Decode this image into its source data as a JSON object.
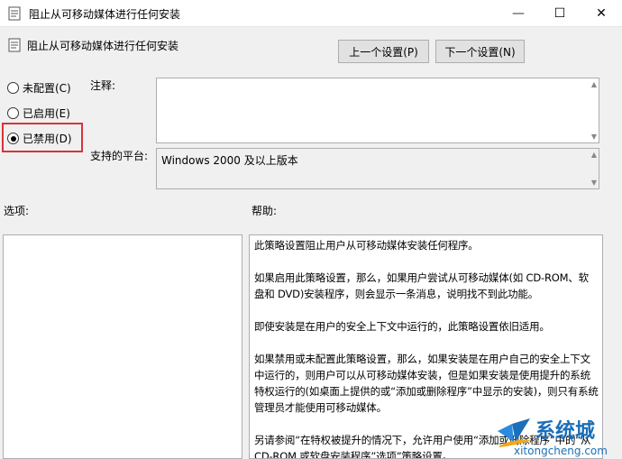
{
  "window": {
    "title": "阻止从可移动媒体进行任何安装",
    "controls": {
      "minimize": "—",
      "maximize": "☐",
      "close": "✕"
    }
  },
  "header": {
    "policy_name": "阻止从可移动媒体进行任何安装",
    "prev_button": "上一个设置(P)",
    "next_button": "下一个设置(N)"
  },
  "state": {
    "options": [
      {
        "label": "未配置(C)",
        "selected": false
      },
      {
        "label": "已启用(E)",
        "selected": false
      },
      {
        "label": "已禁用(D)",
        "selected": true
      }
    ],
    "highlight_color": "#d9333b"
  },
  "comment": {
    "label": "注释:",
    "value": ""
  },
  "platform": {
    "label": "支持的平台:",
    "value": "Windows 2000 及以上版本"
  },
  "options_pane": {
    "label": "选项:"
  },
  "help_pane": {
    "label": "帮助:",
    "paragraphs": [
      "此策略设置阻止用户从可移动媒体安装任何程序。",
      "如果启用此策略设置，那么，如果用户尝试从可移动媒体(如 CD-ROM、软盘和 DVD)安装程序，则会显示一条消息，说明找不到此功能。",
      "即使安装是在用户的安全上下文中运行的，此策略设置依旧适用。",
      "如果禁用或未配置此策略设置，那么，如果安装是在用户自己的安全上下文中运行的，则用户可以从可移动媒体安装，但是如果安装是使用提升的系统特权运行的(如桌面上提供的或“添加或删除程序”中显示的安装)，则只有系统管理员才能使用可移动媒体。",
      "另请参阅“在特权被提升的情况下，允许用户使用“添加或删除程序”中的“从CD-ROM 或软盘安装程序”选项”策略设置。"
    ]
  },
  "watermark": {
    "name": "系统城",
    "url": "xitongcheng.com"
  }
}
